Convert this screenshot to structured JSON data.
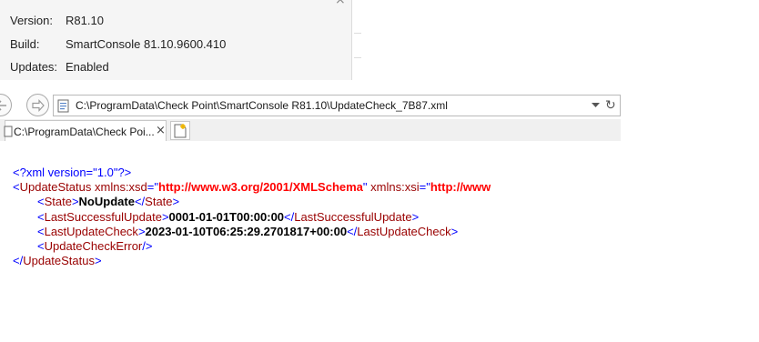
{
  "info_panel": {
    "rows": [
      {
        "key": "Version:",
        "value": "R81.10"
      },
      {
        "key": "Build:",
        "value": "SmartConsole 81.10.9600.410"
      },
      {
        "key": "Updates:",
        "value": "Enabled"
      }
    ],
    "close_glyph": "×"
  },
  "browser": {
    "address": "C:\\ProgramData\\Check Point\\SmartConsole R81.10\\UpdateCheck_7B87.xml",
    "tab_label": "C:\\ProgramData\\Check Poi...",
    "tab_close": "×",
    "refresh_glyph": "↻"
  },
  "xml": {
    "declaration": "<?xml version=\"1.0\"?>",
    "root_open_lt": "<",
    "root_name": "UpdateStatus",
    "attr1_name": "xmlns:xsd",
    "attr1_eq": "=\"",
    "attr1_value": "http://www.w3.org/2001/XMLSchema",
    "attr1_close": "\"",
    "attr2_name": "xmlns:xsi",
    "attr2_eq": "=\"",
    "attr2_value": "http://www",
    "state_tag": "State",
    "state_value": "NoUpdate",
    "last_success_tag": "LastSuccessfulUpdate",
    "last_success_value": "0001-01-01T00:00:00",
    "last_check_tag": "LastUpdateCheck",
    "last_check_value": "2023-01-10T06:25:29.2701817+00:00",
    "error_tag": "UpdateCheckError",
    "root_close": "UpdateStatus",
    "lt": "<",
    "gt": ">",
    "lt_slash": "</",
    "slash_gt": "/>"
  },
  "colors": {
    "markup": "#0000ff",
    "tag_name": "#990000",
    "attr_value": "#ff0000",
    "text_value": "#000000"
  }
}
